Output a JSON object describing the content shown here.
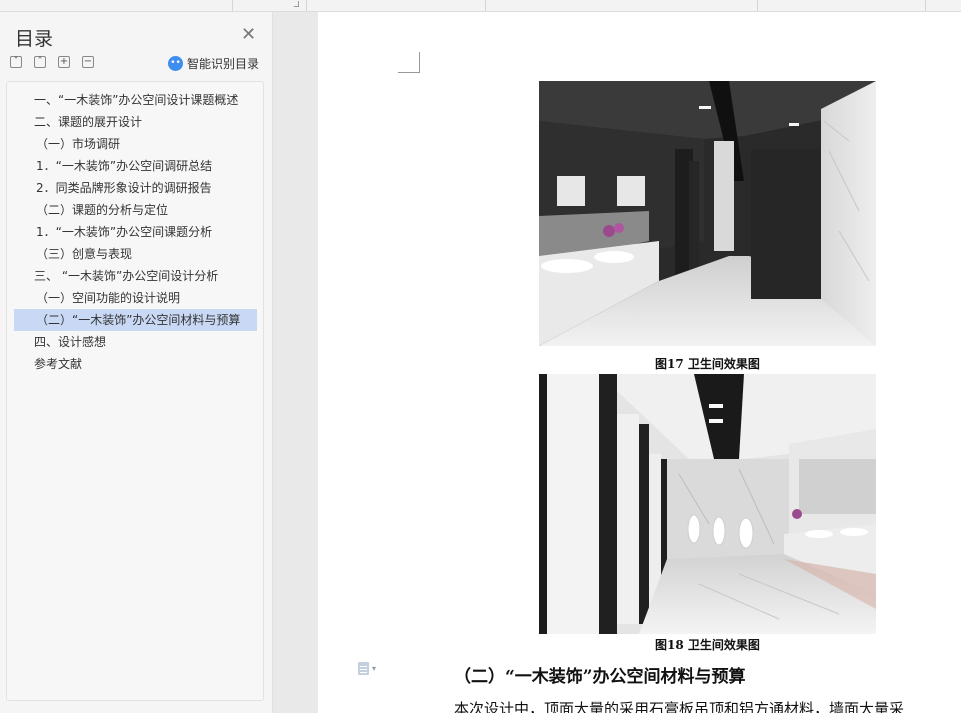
{
  "sidebar": {
    "title": "目录",
    "smart_toc_label": "智能识别目录",
    "items": [
      "一、“一木装饰”办公空间设计课题概述",
      "二、课题的展开设计",
      "（一）市场调研",
      "1．“一木装饰”办公空间调研总结",
      "2．同类品牌形象设计的调研报告",
      "（二）课题的分析与定位",
      "1．“一木装饰”办公空间课题分析",
      "（三）创意与表现",
      "三、 “一木装饰”办公空间设计分析",
      "（一）空间功能的设计说明",
      "（二）“一木装饰”办公空间材料与预算",
      "四、设计感想",
      "参考文献"
    ],
    "active_index": 10
  },
  "document": {
    "figure17_caption": "图17  卫生间效果图",
    "figure18_caption": "图18  卫生间效果图",
    "section_heading": "（二）“一木装饰”办公空间材料与预算",
    "body_text": "本次设计中，顶面大量的采用石膏板吊顶和铝方通材料，墙面大量采"
  },
  "colors": {
    "active_item": "#c9d9f5",
    "smart_icon": "#3d8ef0"
  }
}
